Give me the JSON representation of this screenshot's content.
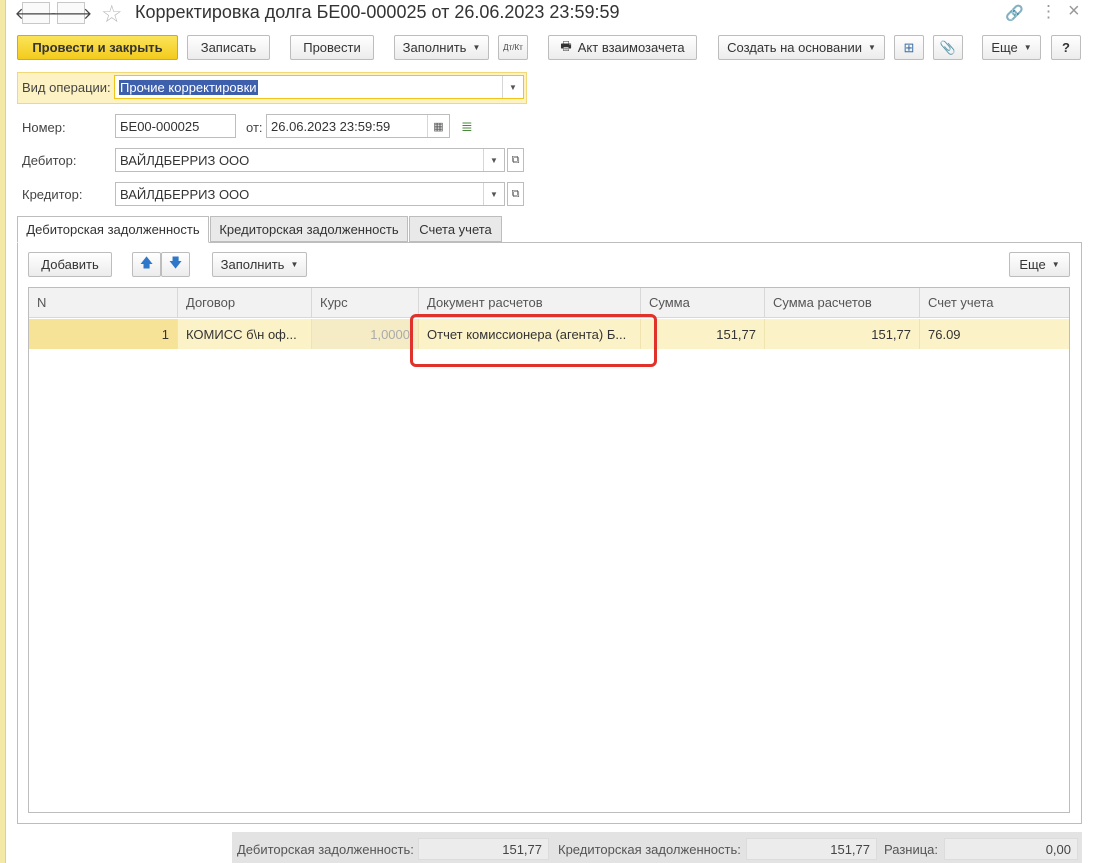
{
  "window": {
    "title": "Корректировка долга БЕ00-000025 от 26.06.2023 23:59:59",
    "back_glyph": "🡐",
    "forward_glyph": "🡒",
    "star_glyph": "☆",
    "link_glyph": "🔗",
    "more_glyph": "⋮",
    "close_glyph": "×"
  },
  "toolbar": {
    "post_and_close": "Провести и закрыть",
    "save": "Записать",
    "post": "Провести",
    "fill": "Заполнить",
    "dt_kt": "Дт/Кт",
    "act": "Акт взаимозачета",
    "create_based": "Создать на основании",
    "more": "Еще",
    "help": "?"
  },
  "form": {
    "operation_label": "Вид операции:",
    "operation_value": "Прочие корректировки",
    "number_label": "Номер:",
    "number_value": "БЕ00-000025",
    "from_label": "от:",
    "date_value": "26.06.2023 23:59:59",
    "debtor_label": "Дебитор:",
    "debtor_value": "ВАЙЛДБЕРРИЗ ООО",
    "creditor_label": "Кредитор:",
    "creditor_value": "ВАЙЛДБЕРРИЗ ООО"
  },
  "tabs": [
    {
      "label": "Дебиторская задолженность"
    },
    {
      "label": "Кредиторская задолженность"
    },
    {
      "label": "Счета учета"
    }
  ],
  "table_toolbar": {
    "add": "Добавить",
    "fill": "Заполнить",
    "more": "Еще"
  },
  "table": {
    "columns": [
      "N",
      "Договор",
      "Курс",
      "Документ расчетов",
      "Сумма",
      "Сумма расчетов",
      "Счет учета"
    ],
    "rows": [
      {
        "n": "1",
        "contract": "КОМИСС б\\н оф...",
        "rate": "1,0000",
        "doc": "Отчет комиссионера (агента) Б...",
        "sum": "151,77",
        "settle_sum": "151,77",
        "account": "76.09"
      }
    ]
  },
  "footer": {
    "debit_label": "Дебиторская задолженность:",
    "debit_value": "151,77",
    "credit_label": "Кредиторская задолженность:",
    "credit_value": "151,77",
    "diff_label": "Разница:",
    "diff_value": "0,00"
  },
  "colors": {
    "accent_yellow": "#f3cb1c",
    "row_highlight": "#fcf2c8",
    "annotation_red": "#e0322a"
  }
}
